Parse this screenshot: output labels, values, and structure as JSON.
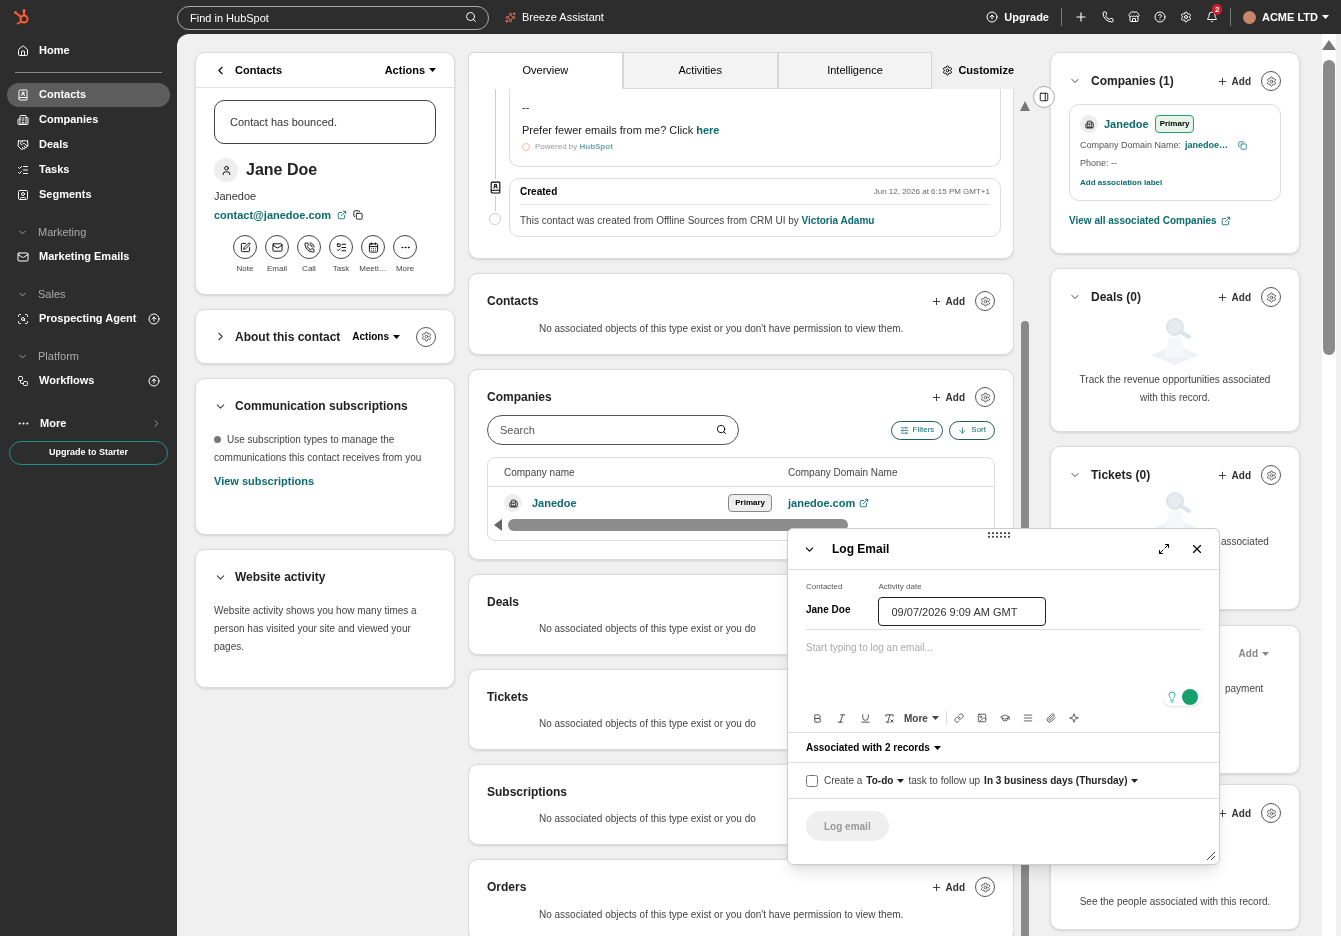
{
  "topbar": {
    "search_placeholder": "Find in HubSpot",
    "assistant": "Breeze Assistant",
    "upgrade": "Upgrade",
    "notifications": "2",
    "account": "ACME LTD"
  },
  "sidebar": {
    "items": [
      {
        "kind": "item",
        "label": "Home",
        "selected": false,
        "upgrade": false
      },
      {
        "kind": "divider"
      },
      {
        "kind": "item",
        "label": "Contacts",
        "selected": true,
        "upgrade": false
      },
      {
        "kind": "item",
        "label": "Companies",
        "selected": false,
        "upgrade": false
      },
      {
        "kind": "item",
        "label": "Deals",
        "selected": false,
        "upgrade": false
      },
      {
        "kind": "item",
        "label": "Tasks",
        "selected": false,
        "upgrade": false
      },
      {
        "kind": "item",
        "label": "Segments",
        "selected": false,
        "upgrade": false
      },
      {
        "kind": "heading",
        "label": "Marketing"
      },
      {
        "kind": "item",
        "label": "Marketing Emails",
        "selected": false,
        "upgrade": false
      },
      {
        "kind": "heading",
        "label": "Sales"
      },
      {
        "kind": "item",
        "label": "Prospecting Agent",
        "selected": false,
        "upgrade": true
      },
      {
        "kind": "heading",
        "label": "Platform"
      },
      {
        "kind": "item",
        "label": "Workflows",
        "selected": false,
        "upgrade": true
      },
      {
        "kind": "more",
        "label": "More"
      }
    ],
    "upgrade_button": "Upgrade to Starter"
  },
  "record": {
    "back": "Contacts",
    "actions": "Actions",
    "alert": "Contact has bounced.",
    "name": "Jane Doe",
    "company": "Janedoe",
    "email": "contact@janedoe.com",
    "quick_actions": [
      "Note",
      "Email",
      "Call",
      "Task",
      "Meeti…",
      "More"
    ]
  },
  "left_cards": [
    {
      "kind": "about",
      "title": "About this contact",
      "expanded": false,
      "actions": "Actions"
    },
    {
      "kind": "subscriptions",
      "title": "Communication subscriptions",
      "expanded": true,
      "text": "Use subscription types to manage the communications this contact receives from you",
      "link": "View subscriptions"
    },
    {
      "kind": "text",
      "title": "Website activity",
      "expanded": true,
      "text": "Website activity shows you how many times a person has visited your site and viewed your pages."
    }
  ],
  "tabs": [
    {
      "label": "Overview",
      "selected": true
    },
    {
      "label": "Activities",
      "selected": false
    },
    {
      "label": "Intelligence",
      "selected": false
    }
  ],
  "customize": "Customize",
  "timeline": {
    "email_lines": [
      "--"
    ],
    "prefer_text": "Prefer fewer emails from me? Click",
    "prefer_link": "here",
    "powered": "Powered by",
    "powered_brand": "HubSpot",
    "created": {
      "title": "Created",
      "time": "Jun 12, 2026 at 6:15 PM GMT+1",
      "text": "This contact was created from Offline Sources from CRM UI by",
      "user": "Victoria Adamu"
    }
  },
  "middle_cards": [
    {
      "kind": "empty",
      "title": "Contacts",
      "add": "Add",
      "text": "No associated objects of this type exist or you don't have permission to view them."
    },
    {
      "kind": "table",
      "title": "Companies",
      "add": "Add",
      "search_placeholder": "Search",
      "filters": "Filters",
      "sort": "Sort",
      "columns": [
        "Company name",
        "Company Domain Name"
      ],
      "rows": [
        {
          "name": "Janedoe",
          "badge": "Primary",
          "domain": "janedoe.com"
        }
      ]
    },
    {
      "kind": "covered",
      "title": "Deals",
      "text": "No associated objects of this type exist or you do"
    },
    {
      "kind": "covered",
      "title": "Tickets",
      "text": "No associated objects of this type exist or you do"
    },
    {
      "kind": "covered",
      "title": "Subscriptions",
      "text": "No associated objects of this type exist or you do"
    },
    {
      "kind": "empty",
      "title": "Orders",
      "add": "Add",
      "text": "No associated objects of this type exist or you don't have permission to view them."
    }
  ],
  "right_cards": [
    {
      "kind": "company",
      "title": "Companies (1)",
      "add": "Add",
      "company": {
        "name": "Janedoe",
        "badge": "Primary",
        "domain_label": "Company Domain Name:",
        "domain": "janedoe…",
        "phone": "Phone: --",
        "label_link": "Add association label"
      },
      "link": "View all associated Companies"
    },
    {
      "kind": "empty",
      "title": "Deals (0)",
      "add": "Add",
      "text": "Track the revenue opportunities associated with this record."
    },
    {
      "kind": "partial",
      "title": "Tickets (0)",
      "add": "Add",
      "fragment": "associated"
    },
    {
      "kind": "hidden",
      "add_menu": "Add",
      "fragment": "payment"
    },
    {
      "kind": "bottom",
      "add": "Add",
      "text": "See the people associated with this record."
    }
  ],
  "log_email": {
    "title": "Log Email",
    "contacted_label": "Contacted",
    "contacted": "Jane Doe",
    "date_label": "Activity date",
    "date": "09/07/2026 9:09 AM GMT",
    "placeholder": "Start typing to log an email...",
    "more": "More",
    "associated": "Associated with 2 records",
    "task": {
      "checked": false,
      "create": "Create a",
      "type": "To-do",
      "middle": "task to follow up",
      "when": "In 3 business days (Thursday)"
    },
    "submit": {
      "label": "Log email",
      "disabled": true
    }
  }
}
